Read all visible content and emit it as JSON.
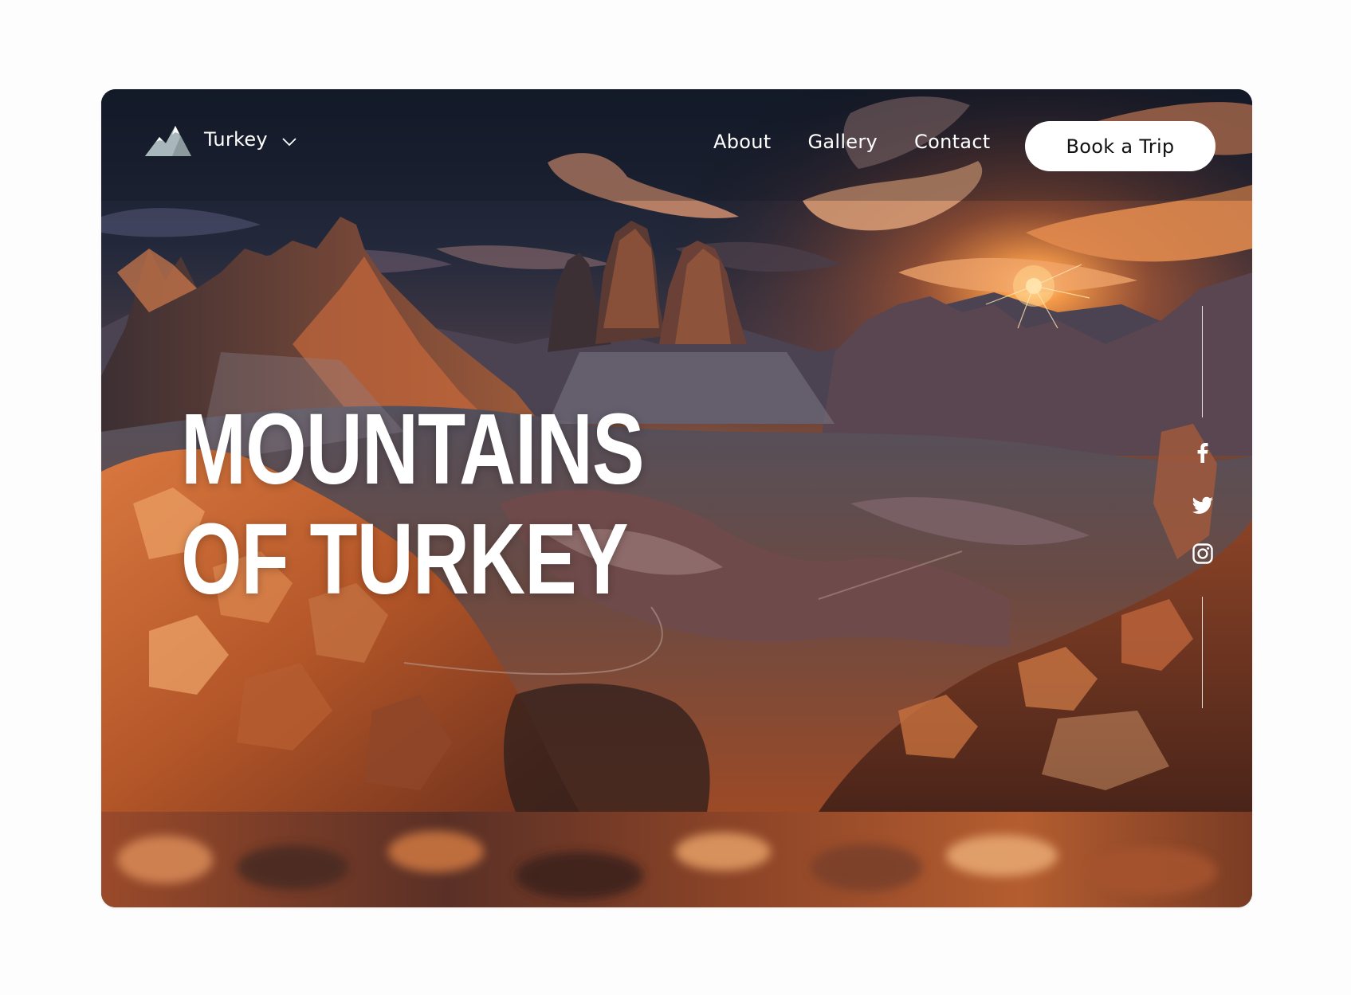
{
  "header": {
    "brand": "Turkey",
    "nav": [
      {
        "label": "About"
      },
      {
        "label": "Gallery"
      },
      {
        "label": "Contact"
      }
    ],
    "cta_label": "Book a Trip"
  },
  "hero": {
    "title_line1": "MOUNTAINS",
    "title_line2": "OF TURKEY",
    "image": "sunset-mountain-landscape"
  },
  "social": {
    "items": [
      "facebook-icon",
      "twitter-icon",
      "instagram-icon"
    ]
  },
  "colors": {
    "text": "#ffffff",
    "button_bg": "#ffffff",
    "button_text": "#111111",
    "sky_dark": "#1b2233",
    "sun": "#ffb04a",
    "rock": "#b8562a"
  }
}
